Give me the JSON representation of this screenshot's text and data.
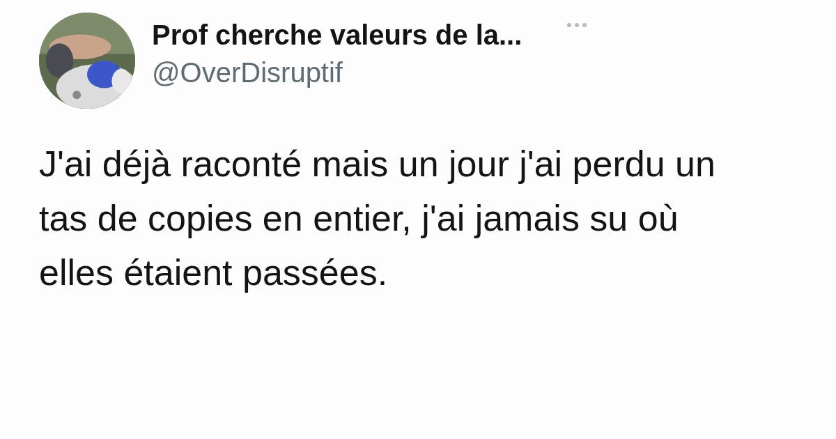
{
  "author": {
    "name": "Prof cherche valeurs de la...",
    "handle": "@OverDisruptif"
  },
  "tweet": {
    "text": "J'ai déjà raconté mais un jour j'ai perdu un tas de copies en entier, j'ai jamais su où elles étaient passées."
  }
}
